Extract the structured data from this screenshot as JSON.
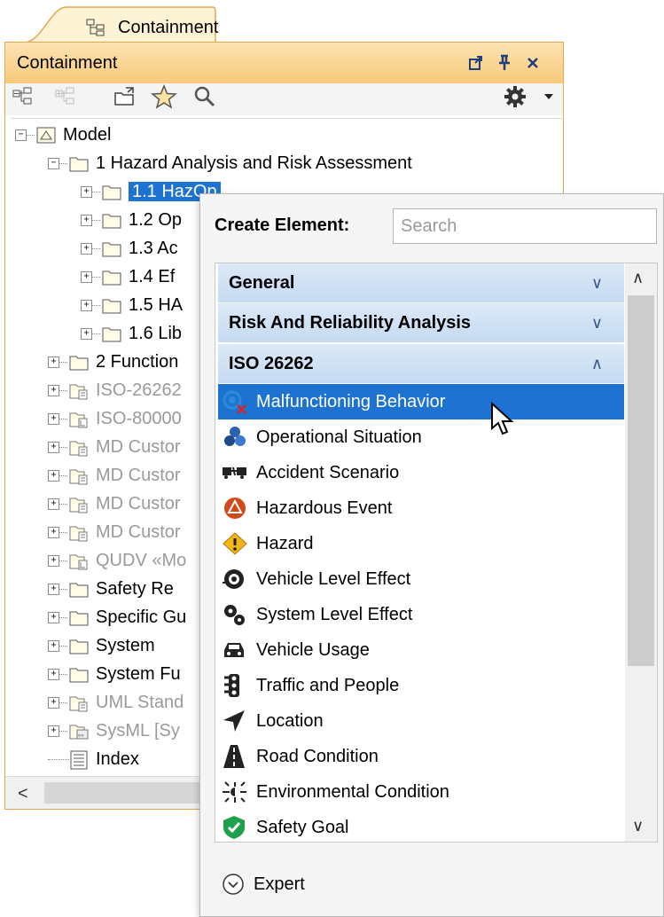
{
  "tab": {
    "label": "Containment"
  },
  "panel": {
    "title": "Containment"
  },
  "tree": {
    "model": "Model",
    "hazard_folder": "1 Hazard Analysis and Risk Assessment",
    "children": [
      "1.1 HazOp",
      "1.2 Op",
      "1.3 Ac",
      "1.4 Ef",
      "1.5 HA",
      "1.6 Lib"
    ],
    "items": [
      "2 Function",
      "ISO-26262",
      "ISO-80000",
      "MD Custor",
      "MD Custor",
      "MD Custor",
      "MD Custor",
      "QUDV «Mo",
      "Safety Re",
      "Specific Gu",
      "System",
      "System Fu",
      "UML Stand",
      "SysML [Sy",
      "Index"
    ]
  },
  "popup": {
    "create_label": "Create Element:",
    "search_placeholder": "Search",
    "categories": [
      "General",
      "Risk And Reliability Analysis",
      "ISO 26262"
    ],
    "items": [
      "Malfunctioning Behavior",
      "Operational Situation",
      "Accident Scenario",
      "Hazardous Event",
      "Hazard",
      "Vehicle Level Effect",
      "System Level Effect",
      "Vehicle Usage",
      "Traffic and People",
      "Location",
      "Road Condition",
      "Environmental Condition",
      "Safety Goal"
    ],
    "expert": "Expert"
  },
  "colors": {
    "selection": "#1e73d2",
    "header": "#f7c97a",
    "category": "#c5daf2"
  }
}
